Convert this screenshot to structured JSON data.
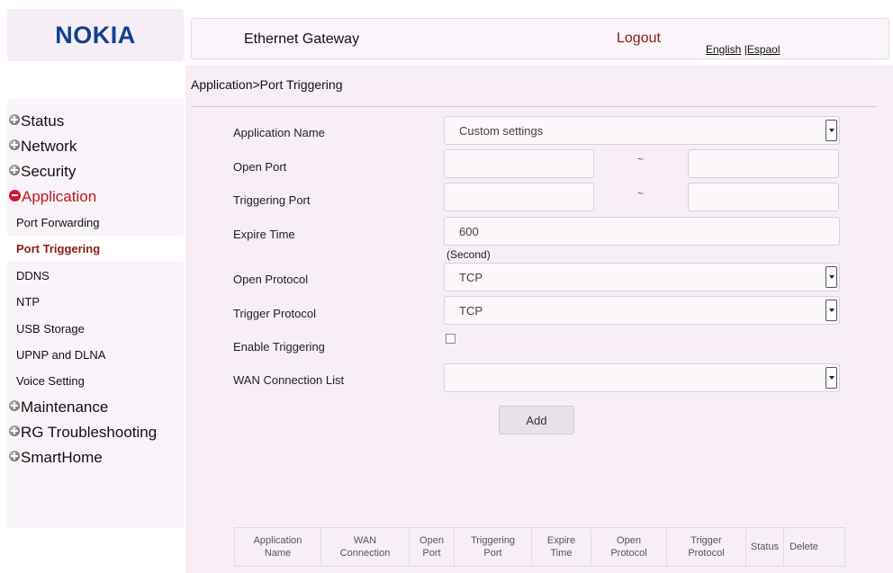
{
  "brand": {
    "logo": "NOKIA",
    "logo_color": "#124191"
  },
  "header": {
    "title": "Ethernet Gateway",
    "logout": "Logout",
    "lang_english": "English",
    "lang_sep": "|",
    "lang_spanish": "Espaol"
  },
  "sidebar": {
    "status": "Status",
    "network": "Network",
    "security": "Security",
    "application": "Application",
    "sub": {
      "port_forwarding": "Port Forwarding",
      "port_triggering": "Port Triggering",
      "ddns": "DDNS",
      "ntp": "NTP",
      "usb_storage": "USB Storage",
      "upnp_dlna": "UPNP and DLNA",
      "voice_setting": "Voice Setting"
    },
    "maintenance": "Maintenance",
    "rg_troubleshooting": "RG Troubleshooting",
    "smarthome": "SmartHome"
  },
  "breadcrumb": "Application>Port Triggering",
  "form": {
    "application_name_label": "Application Name",
    "application_name_value": "Custom settings",
    "open_port_label": "Open Port",
    "open_port_start": "",
    "open_port_end": "",
    "triggering_port_label": "Triggering Port",
    "triggering_port_start": "",
    "triggering_port_end": "",
    "range_sep": "~",
    "expire_time_label": "Expire Time",
    "expire_time_value": "600",
    "expire_time_unit": "(Second)",
    "open_protocol_label": "Open Protocol",
    "open_protocol_value": "TCP",
    "trigger_protocol_label": "Trigger Protocol",
    "trigger_protocol_value": "TCP",
    "enable_triggering_label": "Enable Triggering",
    "enable_triggering_checked": false,
    "wan_connection_label": "WAN Connection List",
    "wan_connection_value": "",
    "add_button": "Add"
  },
  "table": {
    "headers": [
      "Application\nName",
      "WAN\nConnection",
      "Open\nPort",
      "Triggering\nPort",
      "Expire\nTime",
      "Open\nProtocol",
      "Trigger\nProtocol",
      "Status",
      "Delete"
    ]
  }
}
